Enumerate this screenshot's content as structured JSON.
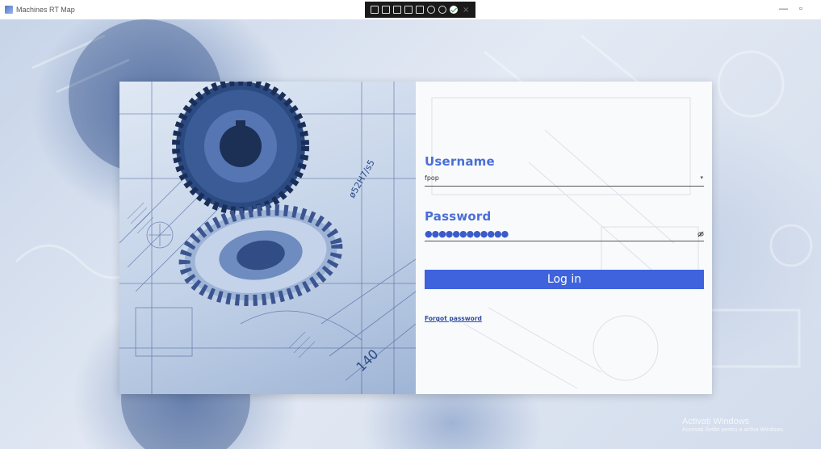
{
  "window": {
    "title": "Machines RT Map",
    "minimize_glyph": "—",
    "maximize_glyph": "▫"
  },
  "toolbar": {
    "icons": [
      "screenshot-icon",
      "window-icon",
      "select-icon",
      "box-icon",
      "monitor-icon",
      "settings-icon",
      "info-icon",
      "check-icon",
      "close-icon"
    ],
    "close_glyph": "×"
  },
  "login": {
    "username_label": "Username",
    "username_value": "fpop",
    "dropdown_glyph": "▾",
    "password_label": "Password",
    "password_mask": "●●●●●●●●●●●●",
    "login_button": "Log in",
    "forgot_password": "Forgot password"
  },
  "watermark": {
    "line1": "Activați Windows",
    "line2": "Accesați Setări pentru a activa Windows."
  },
  "colors": {
    "accent": "#3e63dd",
    "label": "#4a6fd6",
    "link": "#2f4d9e"
  }
}
